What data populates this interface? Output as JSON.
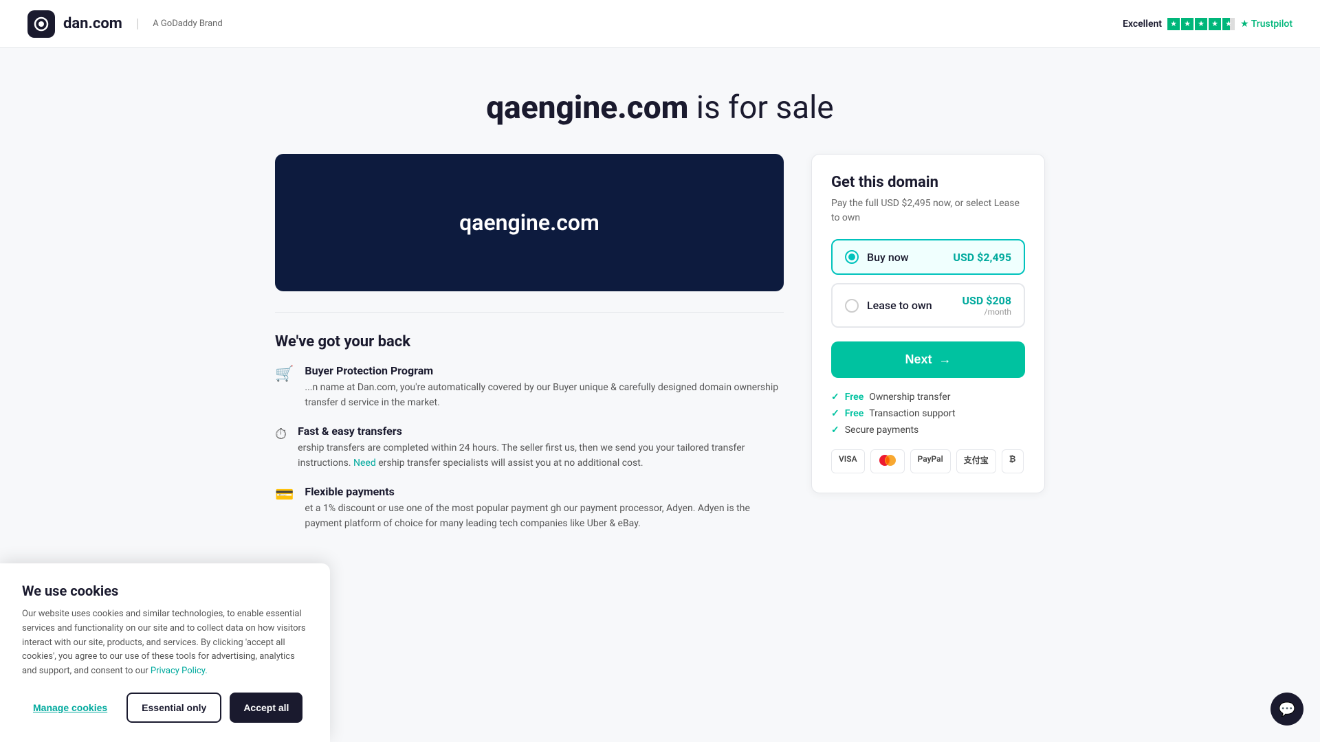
{
  "header": {
    "logo_text": "dan.com",
    "brand_label": "A GoDaddy Brand",
    "trustpilot_label": "Excellent",
    "trustpilot_name": "Trustpilot"
  },
  "page": {
    "domain_name": "qaengine.com",
    "title_suffix": " is for sale",
    "domain_preview_text": "qaengine.com"
  },
  "purchase_panel": {
    "title": "Get this domain",
    "subtitle": "Pay the full USD $2,495 now, or select Lease to own",
    "option_buy_label": "Buy now",
    "option_buy_price": "USD $2,495",
    "option_lease_label": "Lease to own",
    "option_lease_price": "USD $208",
    "option_lease_price_sub": "/month",
    "next_button_label": "Next",
    "features": [
      {
        "badge": "Free",
        "text": "Ownership transfer"
      },
      {
        "badge": "Free",
        "text": "Transaction support"
      },
      {
        "text": "Secure payments",
        "badge": null
      }
    ],
    "payments": [
      "VISA",
      "MC",
      "PayPal",
      "支付宝",
      "₿"
    ]
  },
  "features_section": {
    "title": "We've got your back",
    "items": [
      {
        "name": "Buyer Protection Program",
        "desc_partial": "name at Dan.com, you're automatically covered by our Buyer unique & carefully designed domain ownership transfer d service in the market."
      },
      {
        "name": "Fast & easy transfers",
        "desc": "ership transfers are completed within 24 hours. The seller first us, then we send you your tailored transfer instructions. Need ership transfer specialists will assist you at no additional cost."
      },
      {
        "name": "Flexible payments",
        "desc": "et a 1% discount or use one of the most popular payment gh our payment processor, Adyen. Adyen is the payment platform of choice for many leading tech companies like Uber & eBay."
      }
    ]
  },
  "cookie_banner": {
    "title": "We use cookies",
    "text": "Our website uses cookies and similar technologies, to enable essential services and functionality on our site and to collect data on how visitors interact with our site, products, and services. By clicking 'accept all cookies', you agree to our use of these tools for advertising, analytics and support, and consent to our",
    "privacy_link": "Privacy Policy.",
    "btn_manage": "Manage cookies",
    "btn_essential": "Essential only",
    "btn_accept": "Accept all"
  },
  "chat": {
    "icon": "💬"
  }
}
